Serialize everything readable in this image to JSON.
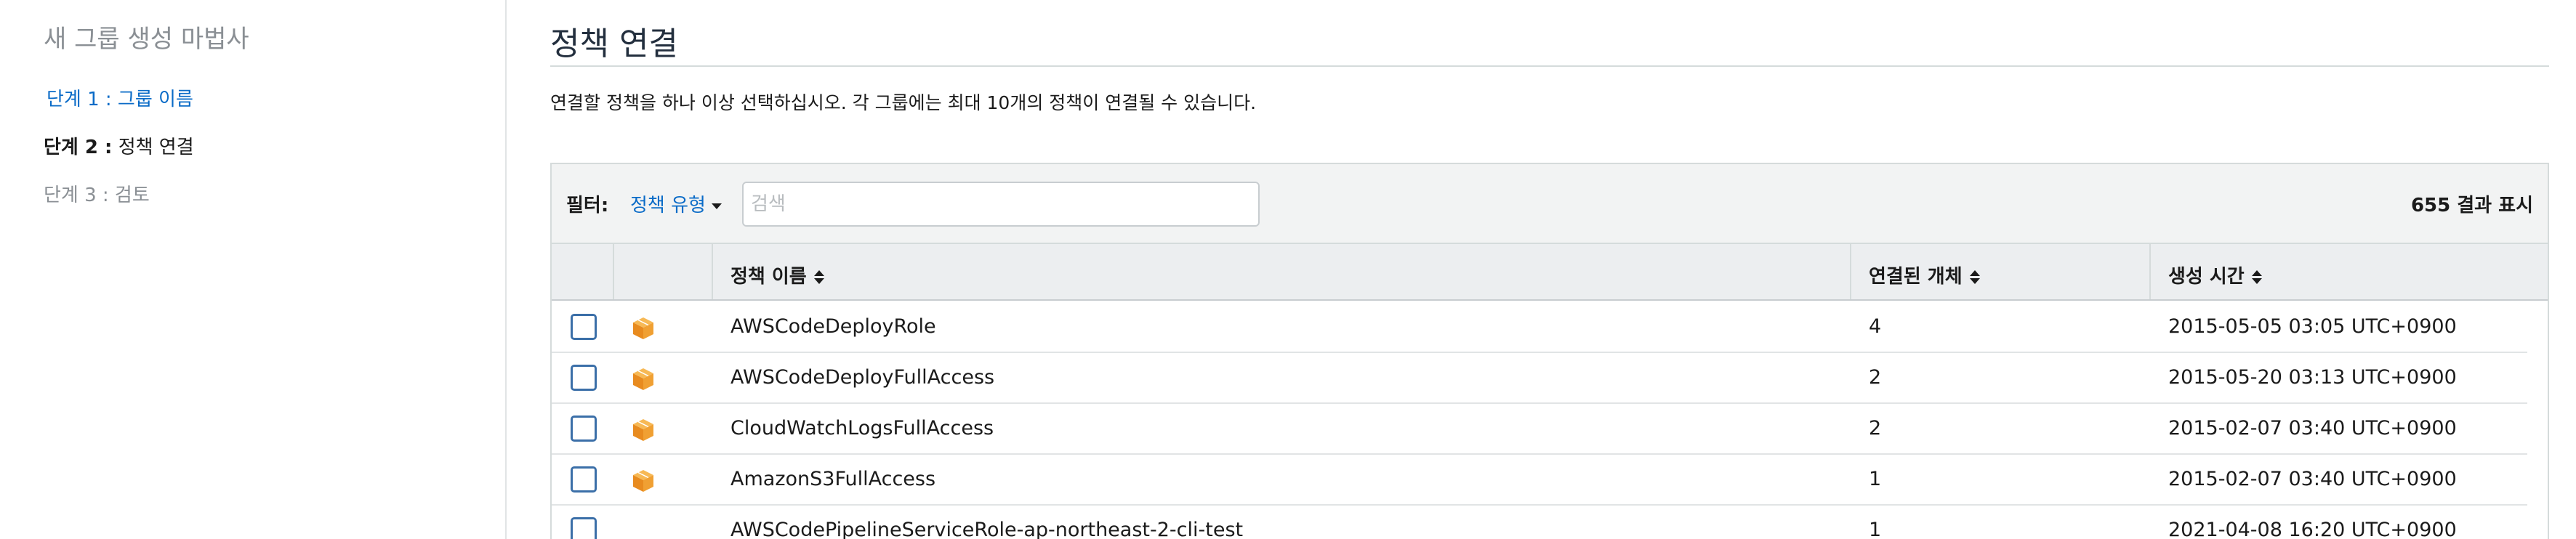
{
  "sidebar": {
    "title": "새 그룹 생성 마법사",
    "steps": [
      {
        "label": "단계 1 : 그룹 이름"
      },
      {
        "prefix": "단계 2 :",
        "label": "정책 연결"
      },
      {
        "label": "단계 3 : 검토"
      }
    ]
  },
  "main": {
    "title": "정책 연결",
    "description": "연결할 정책을 하나 이상 선택하십시오. 각 그룹에는 최대 10개의 정책이 연결될 수 있습니다.",
    "filter": {
      "label": "필터:",
      "policy_type": "정책 유형",
      "search_placeholder": "검색",
      "search_value": "",
      "result_count": "655 결과 표시"
    },
    "table": {
      "columns": {
        "name": "정책 이름",
        "attached": "연결된 개체",
        "created": "생성 시간"
      },
      "rows": [
        {
          "name": "AWSCodeDeployRole",
          "attached": "4",
          "created": "2015-05-05 03:05 UTC+0900",
          "icon": "aws-managed-policy-icon"
        },
        {
          "name": "AWSCodeDeployFullAccess",
          "attached": "2",
          "created": "2015-05-20 03:13 UTC+0900",
          "icon": "aws-managed-policy-icon"
        },
        {
          "name": "CloudWatchLogsFullAccess",
          "attached": "2",
          "created": "2015-02-07 03:40 UTC+0900",
          "icon": "aws-managed-policy-icon"
        },
        {
          "name": "AmazonS3FullAccess",
          "attached": "1",
          "created": "2015-02-07 03:40 UTC+0900",
          "icon": "aws-managed-policy-icon"
        },
        {
          "name": "AWSCodePipelineServiceRole-ap-northeast-2-cli-test",
          "attached": "1",
          "created": "2021-04-08 16:20 UTC+0900",
          "icon": ""
        }
      ]
    }
  },
  "colors": {
    "link": "#0a6bc7",
    "managed_icon": "#f0a033",
    "checkbox_border": "#3b6fa8"
  }
}
